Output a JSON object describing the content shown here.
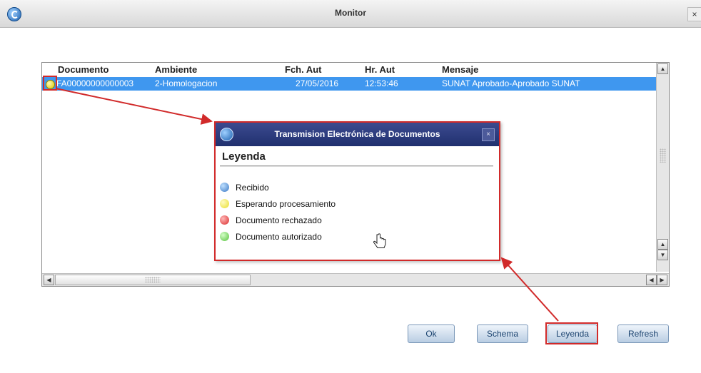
{
  "window": {
    "title": "Monitor",
    "close_label": "×"
  },
  "grid": {
    "columns": [
      "Documento",
      "Ambiente",
      "Fch. Aut",
      "Hr. Aut",
      "Mensaje"
    ],
    "rows": [
      {
        "documento": "FA00000000000003",
        "ambiente": "2-Homologacion",
        "fch_aut": "27/05/2016",
        "hr_aut": "12:53:46",
        "mensaje": "SUNAT Aprobado-Aprobado SUNAT",
        "status": "esperando"
      }
    ]
  },
  "popup": {
    "title": "Transmision Electrónica de Documentos",
    "close_label": "×",
    "heading": "Leyenda",
    "items": [
      {
        "label": "Recibido",
        "color": "#3a78c4"
      },
      {
        "label": "Esperando procesamiento",
        "color": "#e8dd2a"
      },
      {
        "label": "Documento rechazado",
        "color": "#d92b2b"
      },
      {
        "label": "Documento autorizado",
        "color": "#56c13c"
      }
    ]
  },
  "buttons": {
    "ok": "Ok",
    "schema": "Schema",
    "leyenda": "Leyenda",
    "refresh": "Refresh"
  },
  "colors": {
    "selection": "#3f97ef",
    "highlight": "#d12a2a",
    "popup_title": "#2a3a7e"
  },
  "icons": {
    "app_logo": "app-logo-icon",
    "pointer": "hand-pointer-icon"
  }
}
